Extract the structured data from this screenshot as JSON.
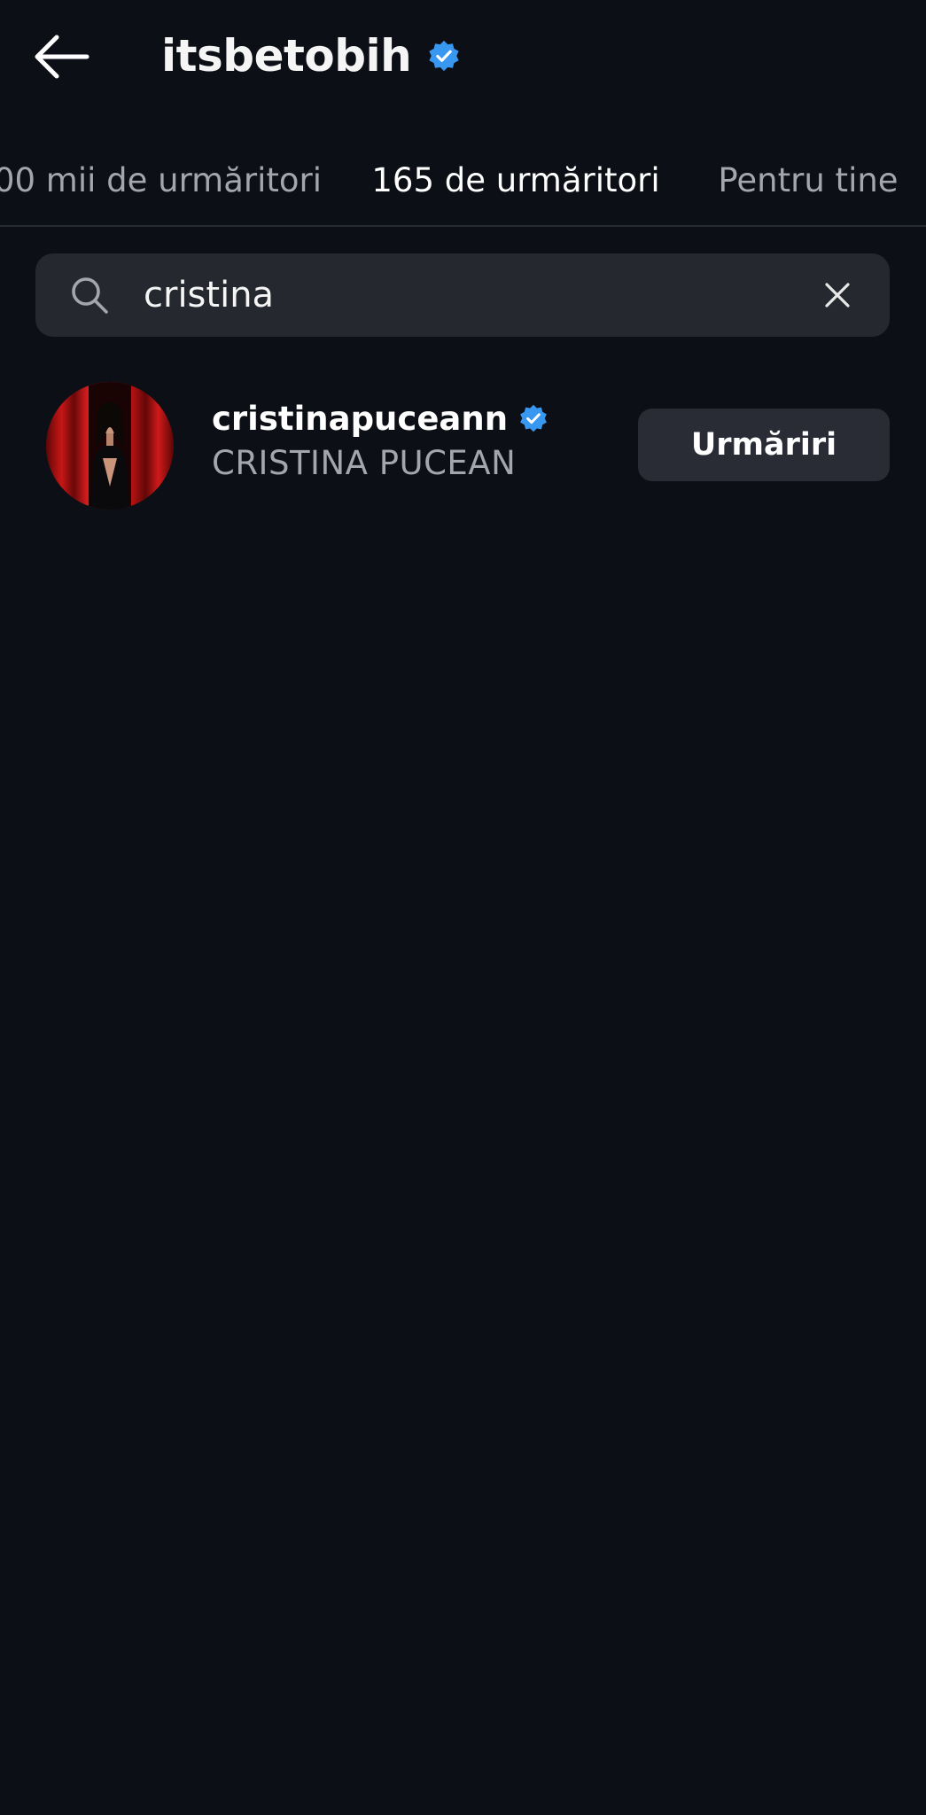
{
  "header": {
    "back_icon": "arrow-left-icon",
    "title": "itsbetobih",
    "verified_icon": "verified-badge-icon"
  },
  "tabs": [
    {
      "label": "00 mii de urmăritori",
      "active": false
    },
    {
      "label": "165 de urmăritori",
      "active": true
    },
    {
      "label": "Pentru tine",
      "active": false
    }
  ],
  "search": {
    "icon": "search-icon",
    "value": "cristina",
    "clear_icon": "close-icon"
  },
  "results": [
    {
      "username": "cristinapuceann",
      "display_name": "CRISTINA PUCEAN",
      "verified": true,
      "button_label": "Urmăriri"
    }
  ],
  "colors": {
    "background": "#0d0f16",
    "verified_blue": "#3897f0",
    "search_bg": "#262830",
    "button_bg": "#2a2c35",
    "secondary_text": "#a3a6ae"
  }
}
